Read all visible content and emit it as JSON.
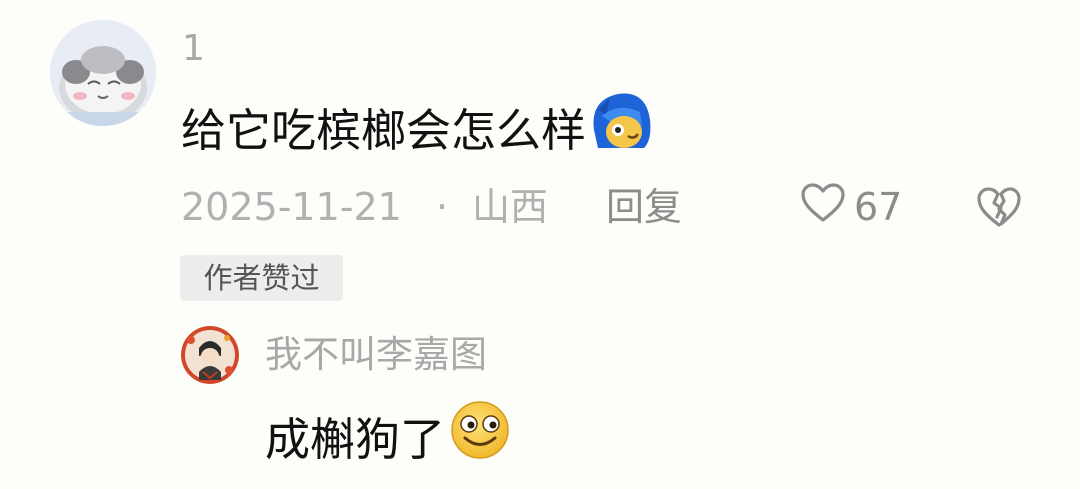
{
  "comment": {
    "username": "1",
    "text": "给它吃槟榔会怎么样",
    "text_emoji": "blue-hair-cartoon-emoji",
    "date": "2025-11-21",
    "separator": "·",
    "location": "山西",
    "reply_label": "回复",
    "like_count": "67",
    "author_liked_label": "作者赞过",
    "icons": {
      "like": "heart-outline-icon",
      "dislike": "broken-heart-icon"
    },
    "colors": {
      "meta_text": "#b0b0b0",
      "badge_bg": "#ededed",
      "content_text": "#111111"
    }
  },
  "reply": {
    "username": "我不叫李嘉图",
    "text": "成槲狗了",
    "text_emoji": "grinning-yellow-face-emoji"
  }
}
